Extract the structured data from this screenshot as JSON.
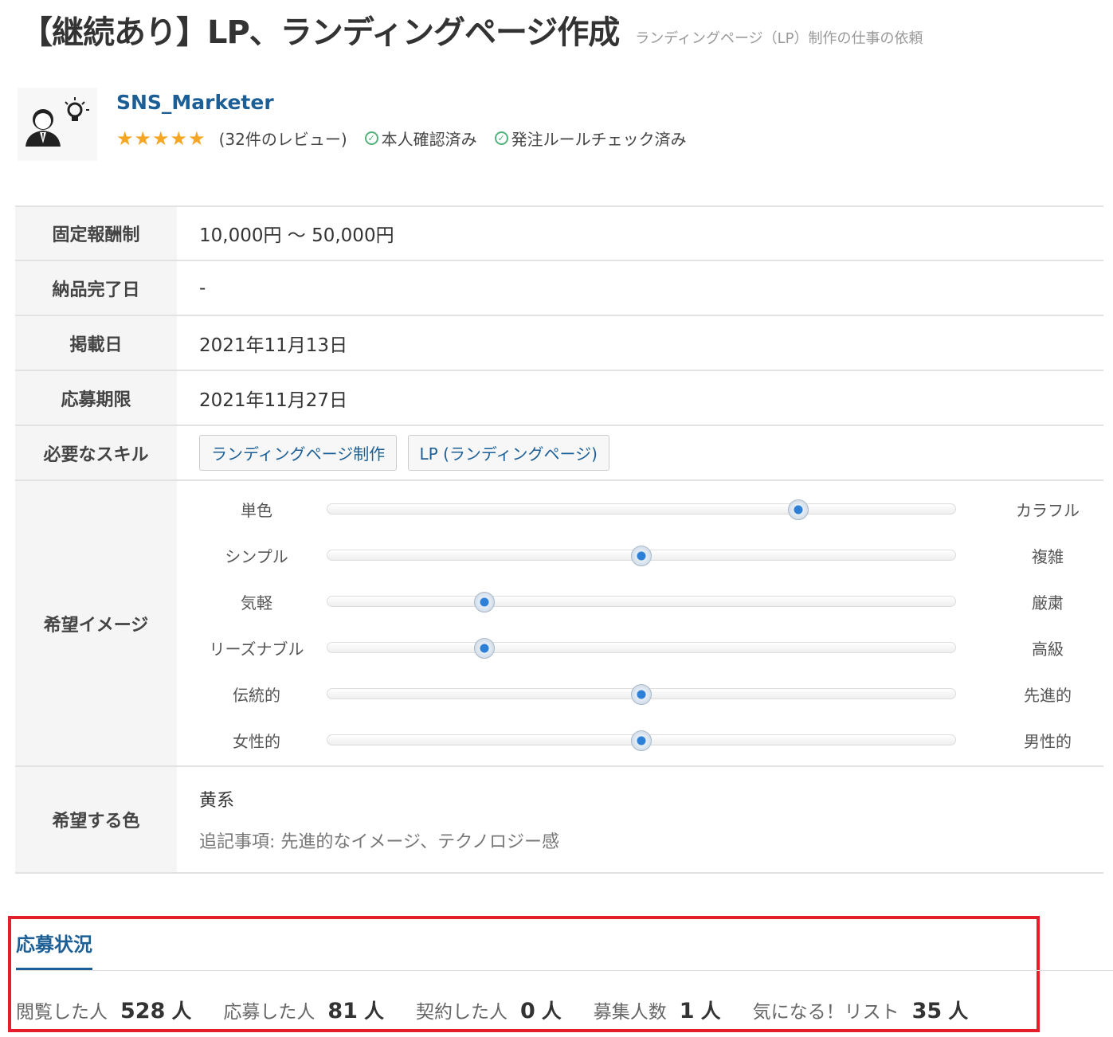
{
  "header": {
    "title": "【継続あり】LP、ランディングページ作成",
    "subtitle": "ランディングページ（LP）制作の仕事の依頼"
  },
  "client": {
    "name": "SNS_Marketer",
    "stars": "★★★★★",
    "rating": 5,
    "reviews": "(32件のレビュー)",
    "badge_identity": "本人確認済み",
    "badge_rules": "発注ルールチェック済み"
  },
  "details": {
    "reward_label": "固定報酬制",
    "reward_value": "10,000円 ～ 50,000円",
    "delivery_label": "納品完了日",
    "delivery_value": "-",
    "posted_label": "掲載日",
    "posted_value": "2021年11月13日",
    "deadline_label": "応募期限",
    "deadline_value": "2021年11月27日",
    "skills_label": "必要なスキル",
    "skills": [
      "ランディングページ制作",
      "LP (ランディングページ)"
    ],
    "image_label": "希望イメージ",
    "image_sliders": [
      {
        "left": "単色",
        "right": "カラフル",
        "level": 0.75
      },
      {
        "left": "シンプル",
        "right": "複雑",
        "level": 0.5
      },
      {
        "left": "気軽",
        "right": "厳粛",
        "level": 0.25
      },
      {
        "left": "リーズナブル",
        "right": "高級",
        "level": 0.25
      },
      {
        "left": "伝統的",
        "right": "先進的",
        "level": 0.5
      },
      {
        "left": "女性的",
        "right": "男性的",
        "level": 0.5
      }
    ],
    "color_label": "希望する色",
    "color_value": "黄系",
    "color_note": "追記事項: 先進的なイメージ、テクノロジー感"
  },
  "status": {
    "tab_label": "応募状況",
    "stats": [
      {
        "label": "閲覧した人",
        "value": "528",
        "unit": "人"
      },
      {
        "label": "応募した人",
        "value": "81",
        "unit": "人"
      },
      {
        "label": "契約した人",
        "value": "0",
        "unit": "人"
      },
      {
        "label": "募集人数",
        "value": "1",
        "unit": "人"
      },
      {
        "label": "気になる！リスト",
        "value": "35",
        "unit": "人"
      }
    ]
  },
  "colors": {
    "link": "#1c5f96",
    "highlight_border": "#e41e2b",
    "star": "#f5a623",
    "check": "#52b37a"
  }
}
